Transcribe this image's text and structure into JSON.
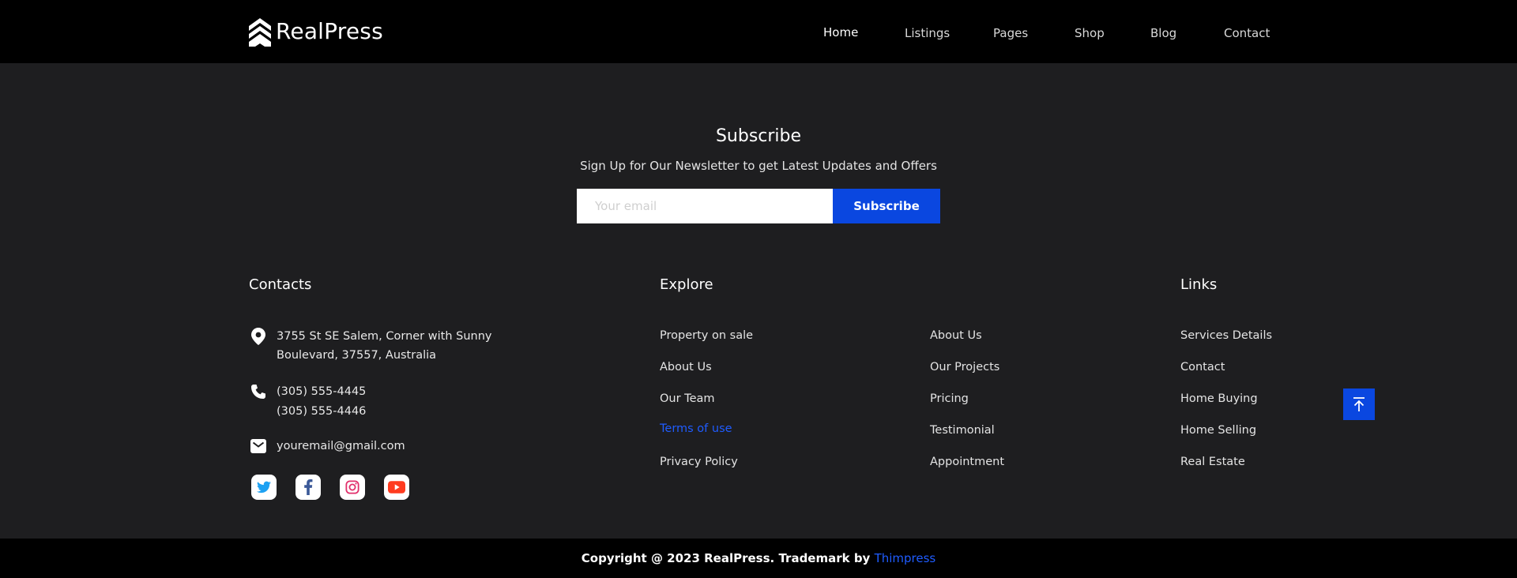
{
  "brand": {
    "name": "RealPress",
    "logo_icon": "realpress-chevron-logo"
  },
  "nav": {
    "items": [
      {
        "label": "Home",
        "active": true
      },
      {
        "label": "Listings",
        "active": false
      },
      {
        "label": "Pages",
        "active": false
      },
      {
        "label": "Shop",
        "active": false
      },
      {
        "label": "Blog",
        "active": false
      },
      {
        "label": "Contact",
        "active": false
      }
    ]
  },
  "subscribe": {
    "title": "Subscribe",
    "text": "Sign Up for Our Newsletter to get Latest Updates and Offers",
    "placeholder": "Your email",
    "button_label": "Subscribe"
  },
  "contacts": {
    "heading": "Contacts",
    "address_line1": "3755 St SE Salem, Corner with Sunny",
    "address_line2": "Boulevard, 37557, Australia",
    "phone1": "(305) 555-4445",
    "phone2": "(305) 555-4446",
    "email": "youremail@gmail.com",
    "icons": [
      "map-pin-icon",
      "phone-icon",
      "envelope-icon"
    ]
  },
  "social": [
    {
      "name": "twitter-icon",
      "color": "#1da1f2"
    },
    {
      "name": "facebook-icon",
      "color": "#3b5998"
    },
    {
      "name": "instagram-icon",
      "color": "#e1306c"
    },
    {
      "name": "youtube-icon",
      "color": "#ff3b1f"
    }
  ],
  "explore": {
    "heading": "Explore",
    "col1": [
      {
        "label": "Property on sale"
      },
      {
        "label": "About Us"
      },
      {
        "label": "Our Team"
      },
      {
        "label": "Terms of use",
        "highlighted": true
      },
      {
        "label": "Privacy Policy"
      }
    ],
    "col2": [
      {
        "label": "About Us"
      },
      {
        "label": "Our Projects"
      },
      {
        "label": "Pricing"
      },
      {
        "label": "Testimonial"
      },
      {
        "label": "Appointment"
      }
    ]
  },
  "links": {
    "heading": "Links",
    "items": [
      {
        "label": "Services Details"
      },
      {
        "label": "Contact"
      },
      {
        "label": "Home Buying"
      },
      {
        "label": "Home Selling"
      },
      {
        "label": "Real Estate"
      }
    ]
  },
  "back_to_top_icon": "arrow-up-to-top-icon",
  "footer": {
    "copyright": "Copyright @ 2023 RealPress. Trademark by ",
    "trademark_link": "Thimpress"
  },
  "colors": {
    "accent": "#0a47e0",
    "link_highlight": "#1f5cff",
    "background": "#1e1e20",
    "bar": "#000000"
  }
}
